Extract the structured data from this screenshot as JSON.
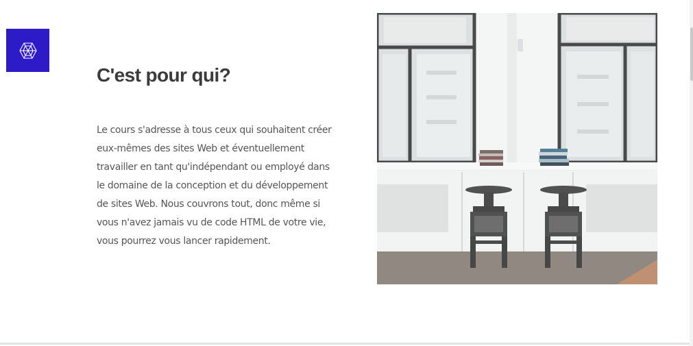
{
  "brand": {
    "logo_icon": "geometric-crystal-icon",
    "logo_bg_color": "#2d1bc8"
  },
  "section": {
    "title": "C'est pour qui?",
    "body": "Le cours s'adresse à tous ceux qui souhaitent créer eux-mêmes des sites Web et éventuellement travailler en tant qu'indépendant ou employé dans le domaine de la conception et du développement de sites Web. Nous couvrons tout, donc même si vous n'avez jamais vu de code HTML de votre vie, vous pourrez vous lancer rapidement."
  },
  "image": {
    "subject": "bright room with tall windows, two bar stools and stacked books on a window sill"
  }
}
